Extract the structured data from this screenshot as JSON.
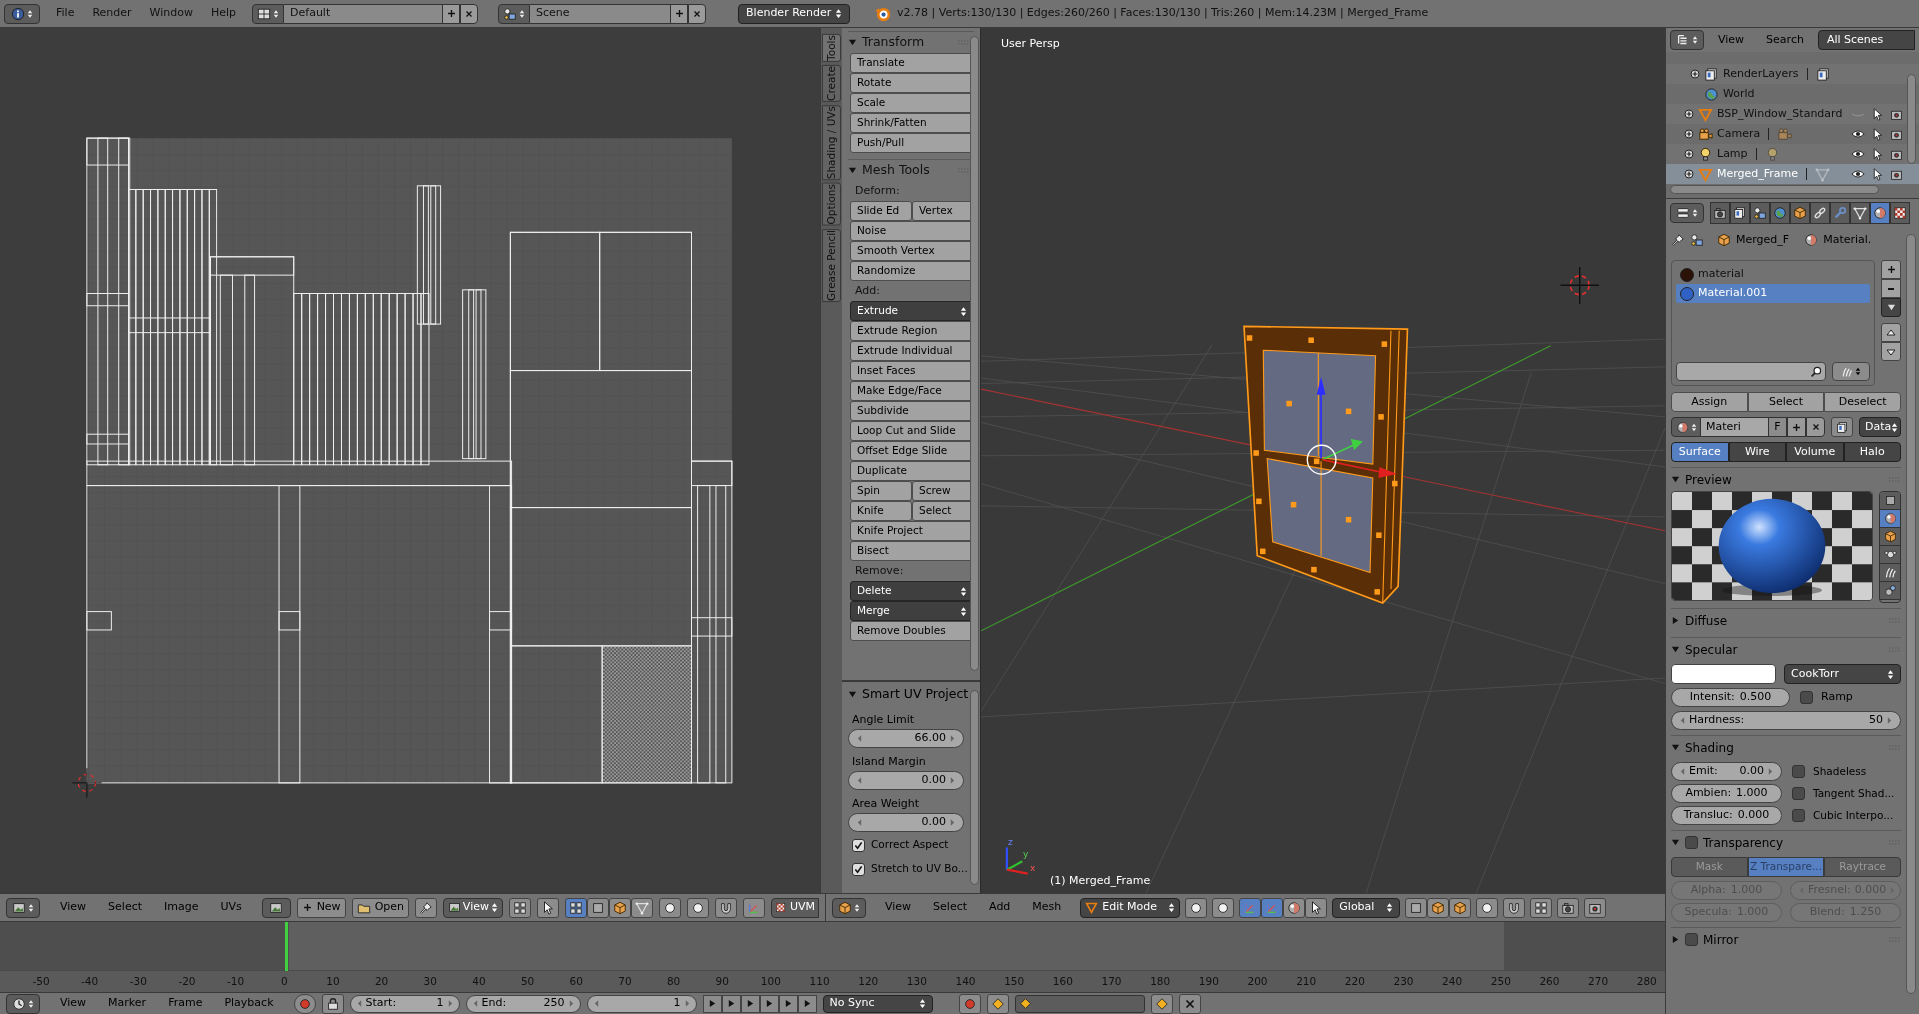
{
  "top_bar": {
    "menus": [
      "File",
      "Render",
      "Window",
      "Help"
    ],
    "screen_layout": "Default",
    "scene": "Scene",
    "render_engine": "Blender Render",
    "stats": "v2.78 | Verts:130/130 | Edges:260/260 | Faces:130/130 | Tris:260 | Mem:14.23M | Merged_Frame"
  },
  "tool_shelf": {
    "tabs": [
      {
        "label": "Tools",
        "selected": true
      },
      {
        "label": "Create",
        "selected": false
      },
      {
        "label": "Shading / UVs",
        "selected": false
      },
      {
        "label": "Options",
        "selected": false
      },
      {
        "label": "Grease Pencil",
        "selected": false
      }
    ],
    "panels": [
      {
        "title": "Transform",
        "expanded": true,
        "rows": [
          {
            "kind": "buttons",
            "labels": [
              "Translate"
            ]
          },
          {
            "kind": "buttons",
            "labels": [
              "Rotate"
            ]
          },
          {
            "kind": "buttons",
            "labels": [
              "Scale"
            ]
          },
          {
            "kind": "buttons",
            "labels": [
              "Shrink/Fatten"
            ]
          },
          {
            "kind": "buttons",
            "labels": [
              "Push/Pull"
            ]
          }
        ]
      },
      {
        "title": "Mesh Tools",
        "expanded": true,
        "rows": [
          {
            "kind": "label",
            "labels": [
              "Deform:"
            ]
          },
          {
            "kind": "buttons",
            "labels": [
              "Slide Ed",
              "Vertex"
            ]
          },
          {
            "kind": "buttons",
            "labels": [
              "Noise"
            ]
          },
          {
            "kind": "buttons",
            "labels": [
              "Smooth Vertex"
            ]
          },
          {
            "kind": "buttons",
            "labels": [
              "Randomize"
            ]
          },
          {
            "kind": "label",
            "labels": [
              "Add:"
            ]
          },
          {
            "kind": "menu",
            "labels": [
              "Extrude"
            ]
          },
          {
            "kind": "buttons",
            "labels": [
              "Extrude Region"
            ]
          },
          {
            "kind": "buttons",
            "labels": [
              "Extrude Individual"
            ]
          },
          {
            "kind": "buttons",
            "labels": [
              "Inset Faces"
            ]
          },
          {
            "kind": "buttons",
            "labels": [
              "Make Edge/Face"
            ]
          },
          {
            "kind": "buttons",
            "labels": [
              "Subdivide"
            ]
          },
          {
            "kind": "buttons",
            "labels": [
              "Loop Cut and Slide"
            ]
          },
          {
            "kind": "buttons",
            "labels": [
              "Offset Edge Slide"
            ]
          },
          {
            "kind": "buttons",
            "labels": [
              "Duplicate"
            ]
          },
          {
            "kind": "buttons",
            "labels": [
              "Spin",
              "Screw"
            ]
          },
          {
            "kind": "buttons",
            "labels": [
              "Knife",
              "Select"
            ]
          },
          {
            "kind": "buttons",
            "labels": [
              "Knife Project"
            ]
          },
          {
            "kind": "buttons",
            "labels": [
              "Bisect"
            ]
          },
          {
            "kind": "label",
            "labels": [
              "Remove:"
            ]
          },
          {
            "kind": "menu",
            "labels": [
              "Delete"
            ]
          },
          {
            "kind": "menu",
            "labels": [
              "Merge"
            ]
          },
          {
            "kind": "buttons",
            "labels": [
              "Remove Doubles"
            ]
          }
        ]
      }
    ]
  },
  "operator_panel": {
    "title": "Smart UV Project",
    "expanded": true,
    "fields": [
      {
        "label": "Angle Limit",
        "value": "66.00"
      },
      {
        "label": "Island Margin",
        "value": "0.00"
      },
      {
        "label": "Area Weight",
        "value": "0.00"
      }
    ],
    "options": [
      {
        "label": "Correct Aspect",
        "checked": true
      },
      {
        "label": "Stretch to UV Bo...",
        "checked": true
      }
    ]
  },
  "viewport": {
    "view_name": "User Persp",
    "object_info": "(1) Merged_Frame",
    "axis_labels": [
      "z",
      "y",
      "x"
    ]
  },
  "uv_header": {
    "menus": [
      "View",
      "Select",
      "Image",
      "UVs"
    ],
    "new_button": "New",
    "open_button": "Open",
    "view_mode": "View",
    "uv_map": "UVM"
  },
  "view3d_header": {
    "menus": [
      "View",
      "Select",
      "Add",
      "Mesh"
    ],
    "mode": "Edit Mode",
    "orientation": "Global"
  },
  "timeline": {
    "ticks": [
      "-50",
      "-40",
      "-30",
      "-20",
      "-10",
      "0",
      "10",
      "20",
      "30",
      "40",
      "50",
      "60",
      "70",
      "80",
      "90",
      "100",
      "110",
      "120",
      "130",
      "140",
      "150",
      "160",
      "170",
      "180",
      "190",
      "200",
      "210",
      "220",
      "230",
      "240",
      "250",
      "260",
      "270",
      "280"
    ],
    "menus": [
      "View",
      "Marker",
      "Frame",
      "Playback"
    ],
    "start_label": "Start:",
    "start": "1",
    "end_label": "End:",
    "end": "250",
    "current_frame": "1",
    "sync": "No Sync"
  },
  "outliner": {
    "menus": [
      "View",
      "Search"
    ],
    "filter": "All Scenes",
    "scene_data": [
      {
        "label": "RenderLayers",
        "kind": "render-layers",
        "expandable": true
      },
      {
        "label": "World",
        "kind": "world",
        "expandable": false
      }
    ],
    "objects": [
      {
        "label": "BSP_Window_Standard",
        "kind": "mesh",
        "visible": false,
        "selected": false
      },
      {
        "label": "Camera",
        "kind": "camera",
        "visible": true,
        "selected": false
      },
      {
        "label": "Lamp",
        "kind": "lamp",
        "visible": true,
        "selected": false
      },
      {
        "label": "Merged_Frame",
        "kind": "mesh",
        "visible": true,
        "selected": true
      }
    ]
  },
  "properties": {
    "tabs": [
      {
        "kind": "render",
        "selected": false
      },
      {
        "kind": "layers",
        "selected": false
      },
      {
        "kind": "scene",
        "selected": false
      },
      {
        "kind": "world",
        "selected": false
      },
      {
        "kind": "object",
        "selected": false
      },
      {
        "kind": "constraints",
        "selected": false
      },
      {
        "kind": "modifiers",
        "selected": false
      },
      {
        "kind": "data",
        "selected": false
      },
      {
        "kind": "material",
        "selected": true
      },
      {
        "kind": "texture",
        "selected": false
      }
    ],
    "breadcrumbs": [
      "Merged_F",
      "Material."
    ],
    "material_slots": [
      {
        "name": "material",
        "color": "#2a1206",
        "selected": false
      },
      {
        "name": "Material.001",
        "color": "#2f62c4",
        "selected": true
      }
    ],
    "slot_actions": [
      "Assign",
      "Select",
      "Deselect"
    ],
    "material_name": "Materi",
    "fake_user": "F",
    "link": "Data",
    "material_types": [
      {
        "label": "Surface",
        "selected": true
      },
      {
        "label": "Wire",
        "selected": false
      },
      {
        "label": "Volume",
        "selected": false
      },
      {
        "label": "Halo",
        "selected": false
      }
    ],
    "preview": {
      "title": "Preview",
      "expanded": true,
      "shapes": [
        {
          "kind": "plane",
          "selected": false
        },
        {
          "kind": "sphere",
          "selected": true
        },
        {
          "kind": "cube",
          "selected": false
        },
        {
          "kind": "monkey",
          "selected": false
        },
        {
          "kind": "hair",
          "selected": false
        },
        {
          "kind": "sky",
          "selected": false
        }
      ]
    },
    "diffuse": {
      "title": "Diffuse",
      "expanded": false
    },
    "specular": {
      "title": "Specular",
      "expanded": true,
      "shader": "CookTorr",
      "intensity": {
        "label": "Intensit:",
        "value": "0.500"
      },
      "ramp": {
        "label": "Ramp",
        "checked": false
      },
      "hardness": {
        "label": "Hardness:",
        "value": "50"
      }
    },
    "shading": {
      "title": "Shading",
      "expanded": true,
      "fields": [
        {
          "kind": "number",
          "label": "Emit:",
          "value": "0.00"
        },
        {
          "kind": "slider",
          "label": "Ambien:",
          "value": "1.000"
        },
        {
          "kind": "slider",
          "label": "Transluc:",
          "value": "0.000"
        }
      ],
      "options": [
        {
          "label": "Shadeless",
          "checked": false
        },
        {
          "label": "Tangent Shad...",
          "checked": false
        },
        {
          "label": "Cubic Interpo...",
          "checked": false
        }
      ]
    },
    "transparency": {
      "title": "Transparency",
      "expanded": true,
      "enabled": false,
      "methods": [
        {
          "label": "Mask",
          "selected": false
        },
        {
          "label": "Z Transpare...",
          "selected": true
        },
        {
          "label": "Raytrace",
          "selected": false
        }
      ],
      "fields": [
        {
          "kind": "slider",
          "label": "Alpha:",
          "value": "1.000",
          "disabled": true
        },
        {
          "kind": "number",
          "label": "Fresnel:",
          "value": "0.000",
          "disabled": true
        },
        {
          "kind": "slider",
          "label": "Specula:",
          "value": "1.000",
          "disabled": true
        },
        {
          "kind": "slider",
          "label": "Blend:",
          "value": "1.250",
          "disabled": true
        }
      ]
    },
    "mirror": {
      "title": "Mirror",
      "expanded": false,
      "enabled": false
    }
  }
}
